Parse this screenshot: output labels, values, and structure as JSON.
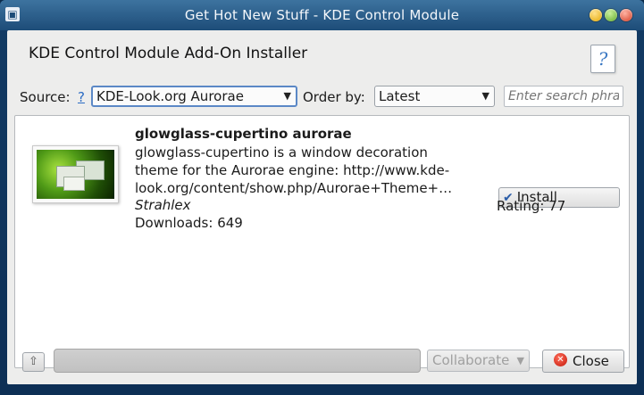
{
  "window": {
    "title": "Get Hot New Stuff - KDE Control Module",
    "app_icon": "kde-window-icon"
  },
  "dialog": {
    "heading": "KDE Control Module Add-On Installer",
    "help_glyph": "?"
  },
  "filters": {
    "source_label": "Source:",
    "source_help": "?",
    "source_value": "KDE-Look.org Aurorae",
    "order_label": "Order by:",
    "order_value": "Latest",
    "search_placeholder": "Enter search phrase here"
  },
  "items": [
    {
      "title": "glowglass-cupertino aurorae",
      "description": "glowglass-cupertino is a window decoration theme for the Aurorae engine: http://www.kde-look.org/content/show.php/Aurorae+Theme+…",
      "author": "Strahlex",
      "downloads": "Downloads: 649",
      "install_label": "Install",
      "rating": "Rating: 77"
    }
  ],
  "footer": {
    "up_glyph": "⇧",
    "progress": 0,
    "collaborate_label": "Collaborate",
    "close_label": "Close"
  },
  "colors": {
    "accent": "#5b88c6",
    "window_background": "#ededec",
    "titlebar": "#1d4c78"
  }
}
